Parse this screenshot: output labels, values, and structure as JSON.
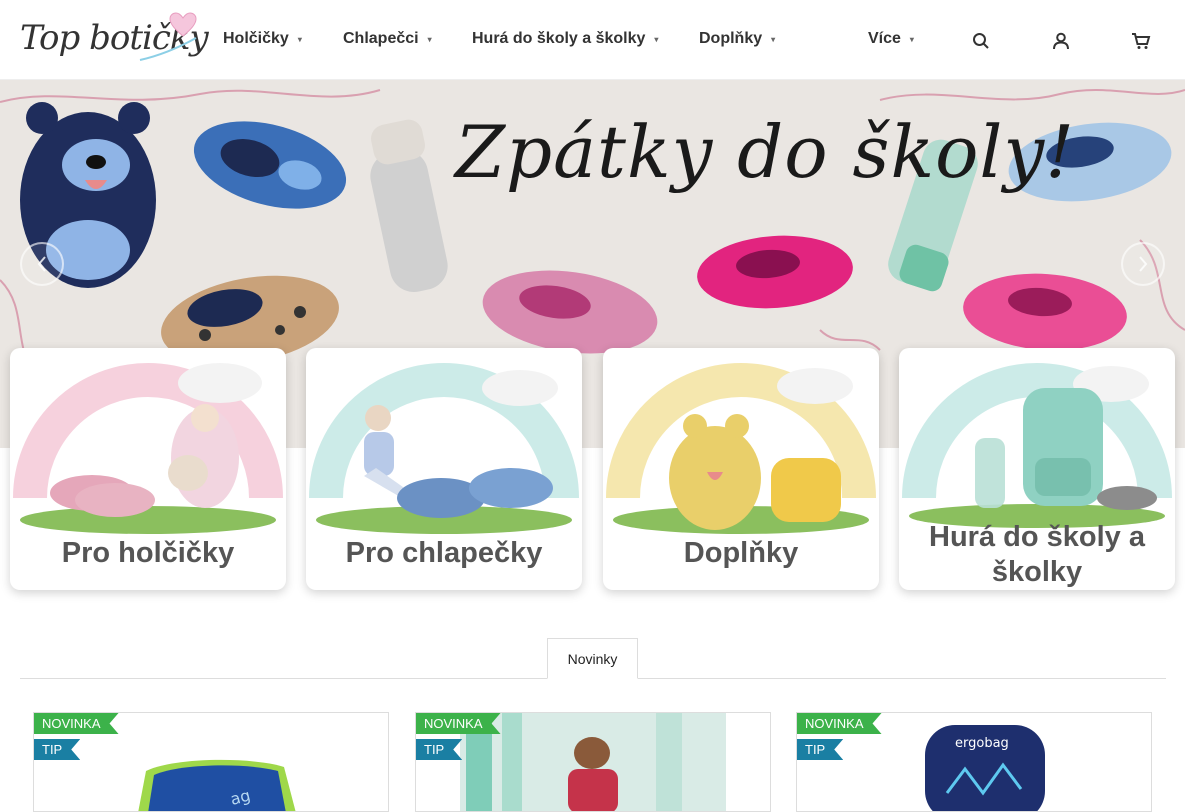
{
  "header": {
    "logo": "Top botičky",
    "nav": [
      {
        "label": "Holčičky"
      },
      {
        "label": "Chlapečci"
      },
      {
        "label": "Hurá do školy a školky"
      },
      {
        "label": "Doplňky"
      },
      {
        "label": "Více"
      }
    ]
  },
  "hero": {
    "title": "Zpátky do školy!"
  },
  "categories": [
    {
      "label": "Pro holčičky"
    },
    {
      "label": "Pro chlapečky"
    },
    {
      "label": "Doplňky"
    },
    {
      "label": "Hurá do školy a školky"
    }
  ],
  "tabs": [
    {
      "label": "Novinky"
    }
  ],
  "products": [
    {
      "badges": [
        "NOVINKA",
        "TIP"
      ]
    },
    {
      "badges": [
        "NOVINKA",
        "TIP"
      ]
    },
    {
      "badges": [
        "NOVINKA",
        "TIP"
      ]
    }
  ],
  "colors": {
    "badge_new": "#3cb24a",
    "badge_tip": "#1a7fa3",
    "hero_bg": "#eae6e2"
  }
}
